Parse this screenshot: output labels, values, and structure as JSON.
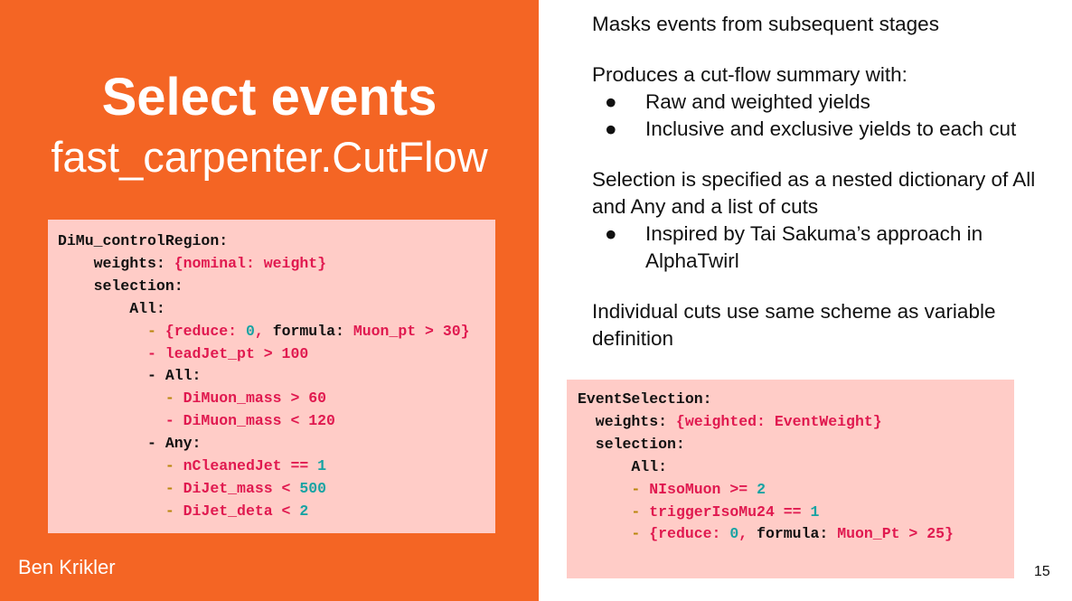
{
  "title": "Select events",
  "subtitle": "fast_carpenter.CutFlow",
  "author": "Ben Krikler",
  "page_number": "15",
  "bullet_glyph": "●",
  "right_text": {
    "p1": "Masks events from subsequent stages",
    "p2": "Produces a cut-flow summary with:",
    "p2_bullets": [
      "Raw and weighted yields",
      "Inclusive and exclusive yields to each cut"
    ],
    "p3": "Selection is specified as a nested dictionary of All and Any and a list of cuts",
    "p3_bullets": [
      "Inspired by Tai Sakuma’s approach in AlphaTwirl"
    ],
    "p4": "Individual cuts use same scheme as variable definition"
  },
  "code_left": [
    [
      [
        "DiMu_controlRegion:",
        "k"
      ]
    ],
    [
      [
        "    weights: ",
        "k"
      ],
      [
        "{nominal: weight}",
        "s"
      ]
    ],
    [
      [
        "    selection:",
        "k"
      ]
    ],
    [
      [
        "        All:",
        "k"
      ]
    ],
    [
      [
        "          ",
        "k"
      ],
      [
        "- ",
        "d"
      ],
      [
        "{reduce: ",
        "s"
      ],
      [
        "0",
        "n"
      ],
      [
        ", ",
        "s"
      ],
      [
        "formula: ",
        "k"
      ],
      [
        "Muon_pt > 30}",
        "s"
      ]
    ],
    [
      [
        "          ",
        "k"
      ],
      [
        "- leadJet_pt > 100",
        "s"
      ]
    ],
    [
      [
        "          - All:",
        "k"
      ]
    ],
    [
      [
        "            ",
        "k"
      ],
      [
        "- ",
        "d"
      ],
      [
        "DiMuon_mass > 60",
        "s"
      ]
    ],
    [
      [
        "            ",
        "k"
      ],
      [
        "- DiMuon_mass < 120",
        "s"
      ]
    ],
    [
      [
        "          - Any:",
        "k"
      ]
    ],
    [
      [
        "            ",
        "k"
      ],
      [
        "- ",
        "d"
      ],
      [
        "nCleanedJet == ",
        "s"
      ],
      [
        "1",
        "n"
      ]
    ],
    [
      [
        "            ",
        "k"
      ],
      [
        "- ",
        "d"
      ],
      [
        "DiJet_mass < ",
        "s"
      ],
      [
        "500",
        "n"
      ]
    ],
    [
      [
        "            ",
        "k"
      ],
      [
        "- ",
        "d"
      ],
      [
        "DiJet_deta < ",
        "s"
      ],
      [
        "2",
        "n"
      ]
    ]
  ],
  "code_right": [
    [
      [
        "EventSelection:",
        "k"
      ]
    ],
    [
      [
        "  weights: ",
        "k"
      ],
      [
        "{weighted: EventWeight}",
        "s"
      ]
    ],
    [
      [
        "  selection:",
        "k"
      ]
    ],
    [
      [
        "      All:",
        "k"
      ]
    ],
    [
      [
        "      ",
        "k"
      ],
      [
        "- ",
        "d"
      ],
      [
        "NIsoMuon >= ",
        "s"
      ],
      [
        "2",
        "n"
      ]
    ],
    [
      [
        "      ",
        "k"
      ],
      [
        "- ",
        "d"
      ],
      [
        "triggerIsoMu24 == ",
        "s"
      ],
      [
        "1",
        "n"
      ]
    ],
    [
      [
        "      ",
        "k"
      ],
      [
        "- ",
        "d"
      ],
      [
        "{reduce: ",
        "s"
      ],
      [
        "0",
        "n"
      ],
      [
        ", ",
        "s"
      ],
      [
        "formula: ",
        "k"
      ],
      [
        "Muon_Pt > 25}",
        "s"
      ]
    ]
  ]
}
